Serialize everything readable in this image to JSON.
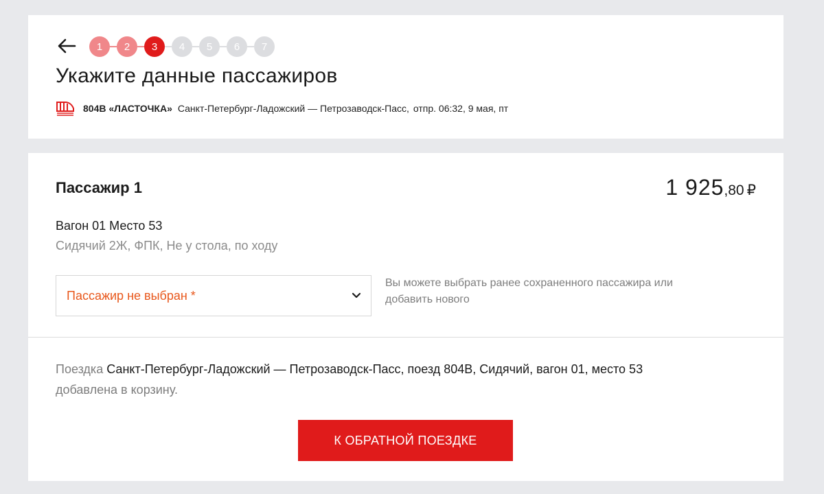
{
  "header": {
    "title": "Укажите данные пассажиров",
    "steps": [
      {
        "label": "1",
        "state": "done"
      },
      {
        "label": "2",
        "state": "done"
      },
      {
        "label": "3",
        "state": "current"
      },
      {
        "label": "4",
        "state": "pending"
      },
      {
        "label": "5",
        "state": "pending"
      },
      {
        "label": "6",
        "state": "pending"
      },
      {
        "label": "7",
        "state": "pending"
      }
    ],
    "train": {
      "icon": "train-icon",
      "name": "804В «ЛАСТОЧКА»",
      "route": "Санкт-Петербург-Ладожский — Петрозаводск-Пасс,",
      "departure": "отпр. 06:32, 9 мая, пт"
    }
  },
  "passenger": {
    "title": "Пассажир 1",
    "price_main": "1 925",
    "price_fraction": ",80",
    "currency": "₽",
    "seat": "Вагон 01 Место 53",
    "seat_details": "Сидячий 2Ж, ФПК, Не у стола, по ходу",
    "select_placeholder": "Пассажир не выбран *",
    "select_hint": "Вы можете выбрать ранее сохраненного пассажира или добавить нового"
  },
  "cart": {
    "prefix": "Поездка",
    "trip": "Санкт-Петербург-Ладожский — Петрозаводск-Пасс, поезд 804В, Сидячий, вагон 01, место 53",
    "suffix": "добавлена в корзину."
  },
  "return_button_label": "К ОБРАТНОЙ ПОЕЗДКЕ",
  "colors": {
    "accent": "#e01b1b",
    "step_done": "#f0878a",
    "step_pending": "#dcdde0",
    "warning_text": "#e8571b"
  }
}
